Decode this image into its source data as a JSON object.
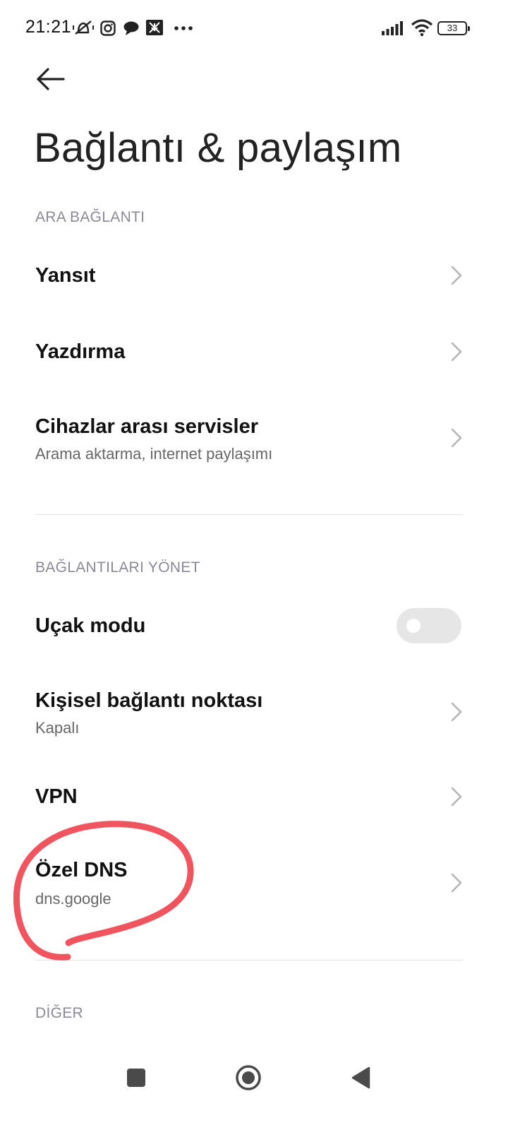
{
  "status_bar": {
    "time": "21:21",
    "icons": [
      "mute-icon",
      "instagram-icon",
      "chat-icon",
      "download-icon",
      "more-icon",
      "signal-icon",
      "wifi-icon"
    ],
    "battery": "33"
  },
  "header": {
    "back_icon": "arrow-left-icon",
    "title": "Bağlantı & paylaşım"
  },
  "sections": [
    {
      "header": "ARA BAĞLANTI",
      "items": [
        {
          "title": "Yansıt",
          "subtitle": "",
          "control": "chevron"
        },
        {
          "title": "Yazdırma",
          "subtitle": "",
          "control": "chevron"
        },
        {
          "title": "Cihazlar arası servisler",
          "subtitle": "Arama aktarma, internet paylaşımı",
          "control": "chevron"
        }
      ]
    },
    {
      "header": "BAĞLANTILARI YÖNET",
      "items": [
        {
          "title": "Uçak modu",
          "subtitle": "",
          "control": "toggle",
          "toggle_on": false
        },
        {
          "title": "Kişisel bağlantı noktası",
          "subtitle": "Kapalı",
          "control": "chevron"
        },
        {
          "title": "VPN",
          "subtitle": "",
          "control": "chevron"
        },
        {
          "title": "Özel DNS",
          "subtitle": "dns.google",
          "control": "chevron"
        }
      ]
    },
    {
      "header": "DİĞER",
      "items": []
    }
  ],
  "colors": {
    "annotation": "#f0555f",
    "section_header": "#8a8a96",
    "toggle_off": "#e6e6e6"
  },
  "nav_bar": {
    "buttons": [
      "recents-square-icon",
      "home-circle-icon",
      "back-triangle-icon"
    ]
  }
}
